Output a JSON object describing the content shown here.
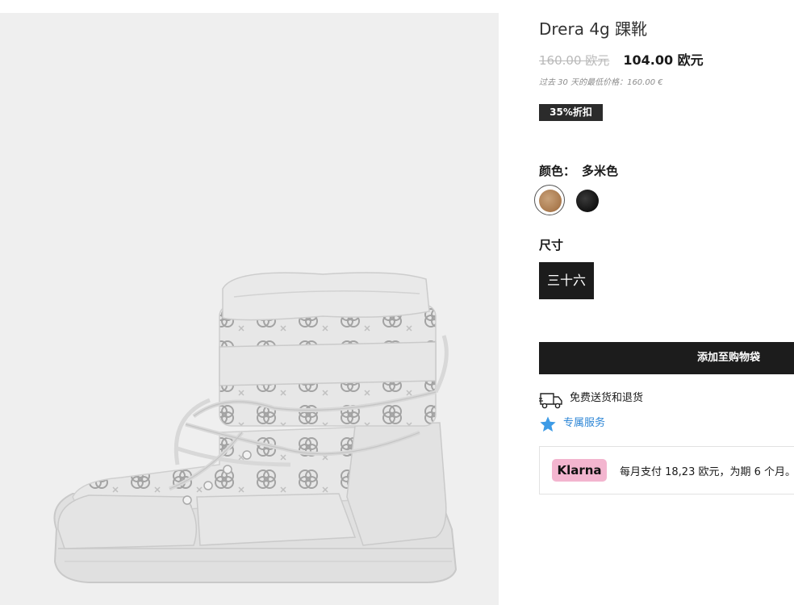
{
  "product": {
    "title": "Drera 4g 踝靴",
    "price_old": "160.00 欧元",
    "price_new": "104.00 欧元",
    "lowest_price_note": "过去 30 天的最低价格：160.00 €",
    "discount_badge": "35%折扣"
  },
  "color": {
    "label": "颜色：",
    "value": "多米色",
    "swatches": [
      {
        "name": "tan",
        "hex": "#a9794d",
        "selected": true
      },
      {
        "name": "black",
        "hex": "#111111",
        "selected": false
      }
    ]
  },
  "size": {
    "label": "尺寸",
    "selected": "三十六"
  },
  "actions": {
    "add_to_bag": "添加至购物袋"
  },
  "services": {
    "shipping": "免费送货和退货",
    "exclusive": "专属服务",
    "shipping_icon": "truck-icon",
    "exclusive_icon": "star-icon",
    "exclusive_color": "#2d86d6"
  },
  "klarna": {
    "logo": "Klarna",
    "text": "每月支付 18,23 欧元，为期 6 个月。",
    "brand_color": "#f3b5cf"
  }
}
